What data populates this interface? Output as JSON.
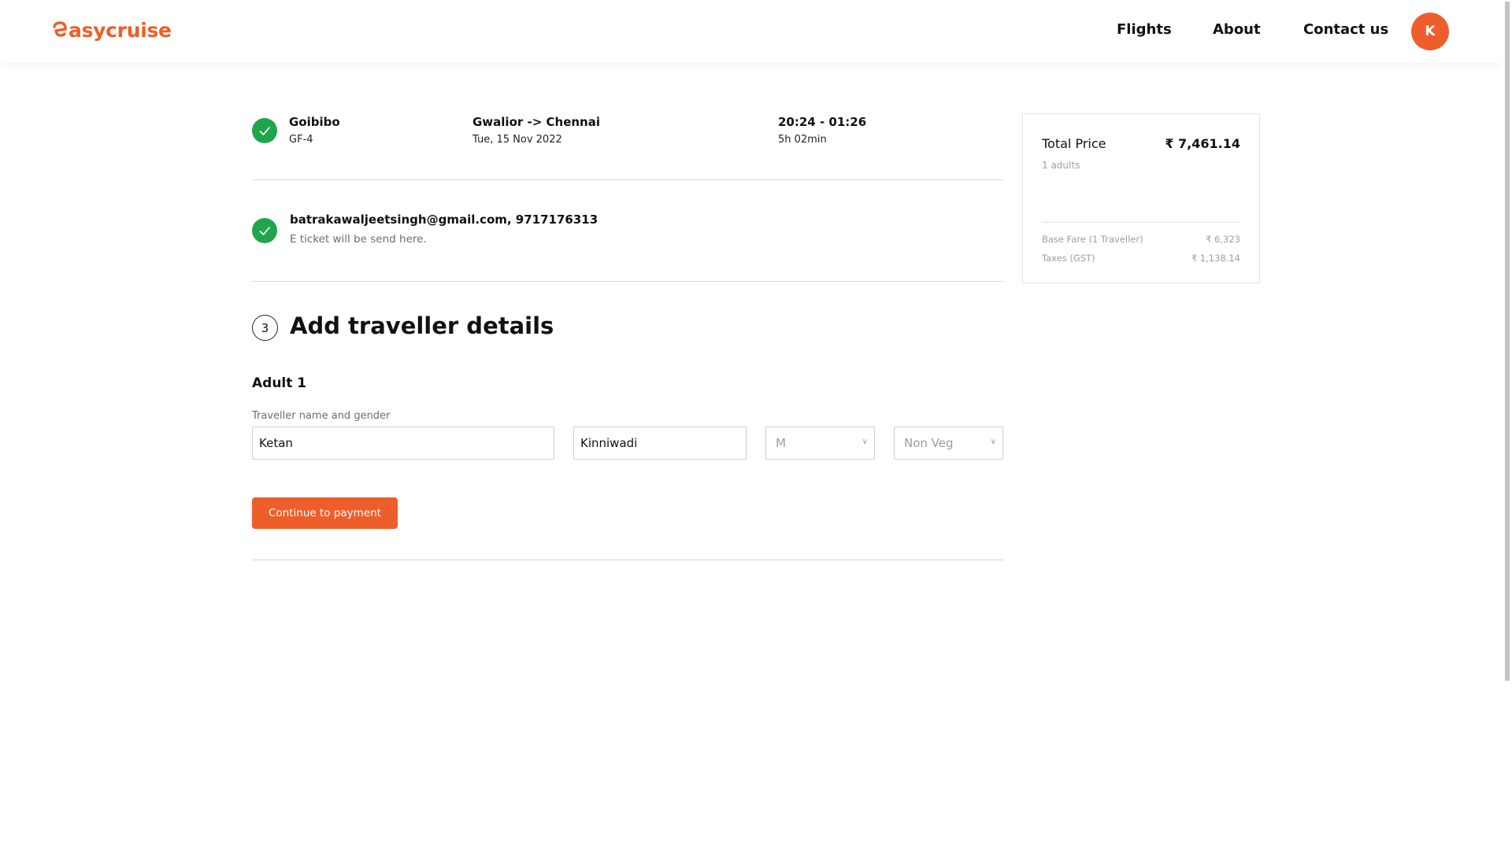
{
  "header": {
    "logo_text": "asycruise",
    "brand_color": "#ee5e27",
    "nav": [
      "Flights",
      "About",
      "Contact us"
    ],
    "avatar_initial": "K"
  },
  "flight": {
    "airline": "Goibibo",
    "flight_code": "GF-4",
    "route": "Gwalior -> Chennai",
    "date": "Tue, 15 Nov 2022",
    "time_range": "20:24 - 01:26",
    "duration": "5h 02min",
    "status_icon": "check-circle-icon"
  },
  "contact": {
    "details": "batrakawaljeetsingh@gmail.com, 9717176313",
    "note": "E ticket will be send here.",
    "status_icon": "check-circle-icon"
  },
  "traveller_section": {
    "step_number": "3",
    "title": "Add traveller details",
    "adult_label": "Adult 1",
    "field_label": "Traveller name and gender",
    "first_name": "Ketan",
    "last_name": "Kinniwadi",
    "gender": "M",
    "meal": "Non Veg",
    "continue_label": "Continue to payment"
  },
  "price_summary": {
    "total_label": "Total Price",
    "total_value": "₹ 7,461.14",
    "passengers": "1 adults",
    "breakdown": [
      {
        "label": "Base Fare (1 Traveller)",
        "value": "₹ 6,323"
      },
      {
        "label": "Taxes (GST)",
        "value": "₹ 1,138.14"
      }
    ]
  }
}
